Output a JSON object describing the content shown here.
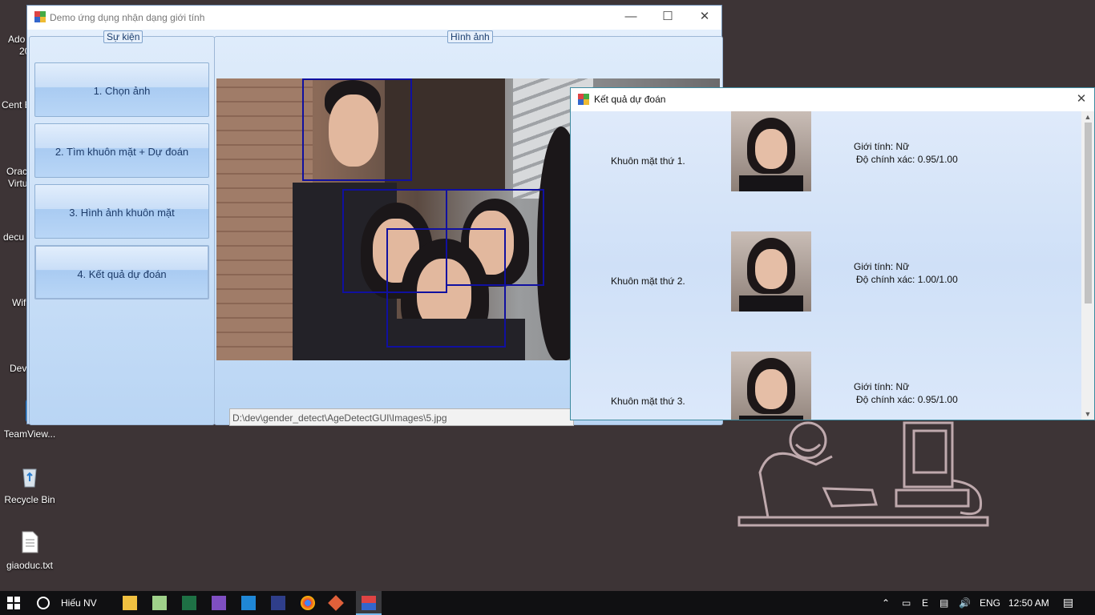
{
  "desktop": {
    "icons": [
      {
        "label": "TeamView...",
        "icon": "teamviewer-icon"
      },
      {
        "label": "Recycle Bin",
        "icon": "recycle-bin-icon"
      },
      {
        "label": "giaoduc.txt",
        "icon": "text-file-icon"
      }
    ],
    "partial_labels": [
      "Ado",
      "20",
      "Cent B",
      "Orac",
      "Virtu",
      "decu",
      "Wif",
      "Dev"
    ]
  },
  "main_window": {
    "title": "Demo ứng dụng nhận dạng giới tính",
    "events_group": {
      "legend": "Sự kiện",
      "buttons": [
        {
          "label": "1. Chọn ảnh"
        },
        {
          "label": "2. Tìm khuôn mặt + Dự đoán"
        },
        {
          "label": "3. Hình ảnh khuôn mặt"
        },
        {
          "label": "4. Kết quả dự đoán"
        }
      ]
    },
    "image_group": {
      "legend": "Hình ảnh",
      "path": "D:\\dev\\gender_detect\\AgeDetectGUI\\Images\\5.jpg"
    }
  },
  "result_window": {
    "title": "Kết quả dự đoán",
    "results": [
      {
        "label": "Khuôn mặt thứ 1.",
        "gender": "Giới tính: Nữ",
        "accuracy": "Độ chính xác: 0.95/1.00"
      },
      {
        "label": "Khuôn mặt thứ 2.",
        "gender": "Giới tính: Nữ",
        "accuracy": "Độ chính xác: 1.00/1.00"
      },
      {
        "label": "Khuôn mặt thứ 3.",
        "gender": "Giới tính: Nữ",
        "accuracy": "Độ chính xác: 0.95/1.00"
      }
    ]
  },
  "taskbar": {
    "search_label": "Hiếu NV",
    "language": "ENG",
    "time": "12:50 AM",
    "pinned": [
      "file-explorer-icon",
      "notepad-icon",
      "excel-icon",
      "visual-studio-icon",
      "vscode-icon",
      "app-icon",
      "chrome-icon",
      "git-icon",
      "gender-app-icon"
    ]
  }
}
